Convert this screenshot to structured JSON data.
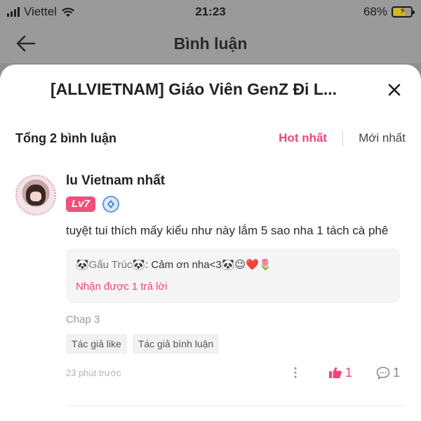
{
  "status_bar": {
    "carrier": "Viettel",
    "time": "21:23",
    "battery": "68%",
    "battery_level": 0.68
  },
  "header": {
    "title": "Bình luận"
  },
  "sheet": {
    "title": "[ALLVIETNAM] Giáo Viên GenZ Đi L..."
  },
  "comments_header": {
    "count_label": "Tổng 2 bình luận",
    "sort_hot": "Hot nhất",
    "sort_new": "Mới nhất"
  },
  "comment": {
    "username": "lu Vietnam nhất",
    "level": "Lv7",
    "text": "tuyệt tui thích mấy kiểu như này lắm 5 sao nha 1 tách cà phê",
    "reply": {
      "author": "🐼Gấu Trúc🐼",
      "separator": ": ",
      "text": "Cảm ơn nha<3🐼😉❤️🌷"
    },
    "reply_count": "Nhận được 1 trả lời",
    "chapter": "Chap 3",
    "tags": [
      "Tác giả like",
      "Tác giả bình luận"
    ],
    "timestamp": "23 phút trước",
    "likes": "1",
    "replies": "1"
  },
  "colors": {
    "accent": "#f0457a",
    "level_badge": "#f0507b",
    "overlay": "#9a9a9a"
  },
  "icons": {
    "back": "arrow-left-icon",
    "close": "close-icon",
    "like": "thumbs-up-icon",
    "reply": "chat-bubble-icon",
    "more": "more-vertical-icon",
    "wifi": "wifi-icon",
    "signal": "signal-icon",
    "battery": "battery-icon",
    "medal": "medal-icon"
  }
}
